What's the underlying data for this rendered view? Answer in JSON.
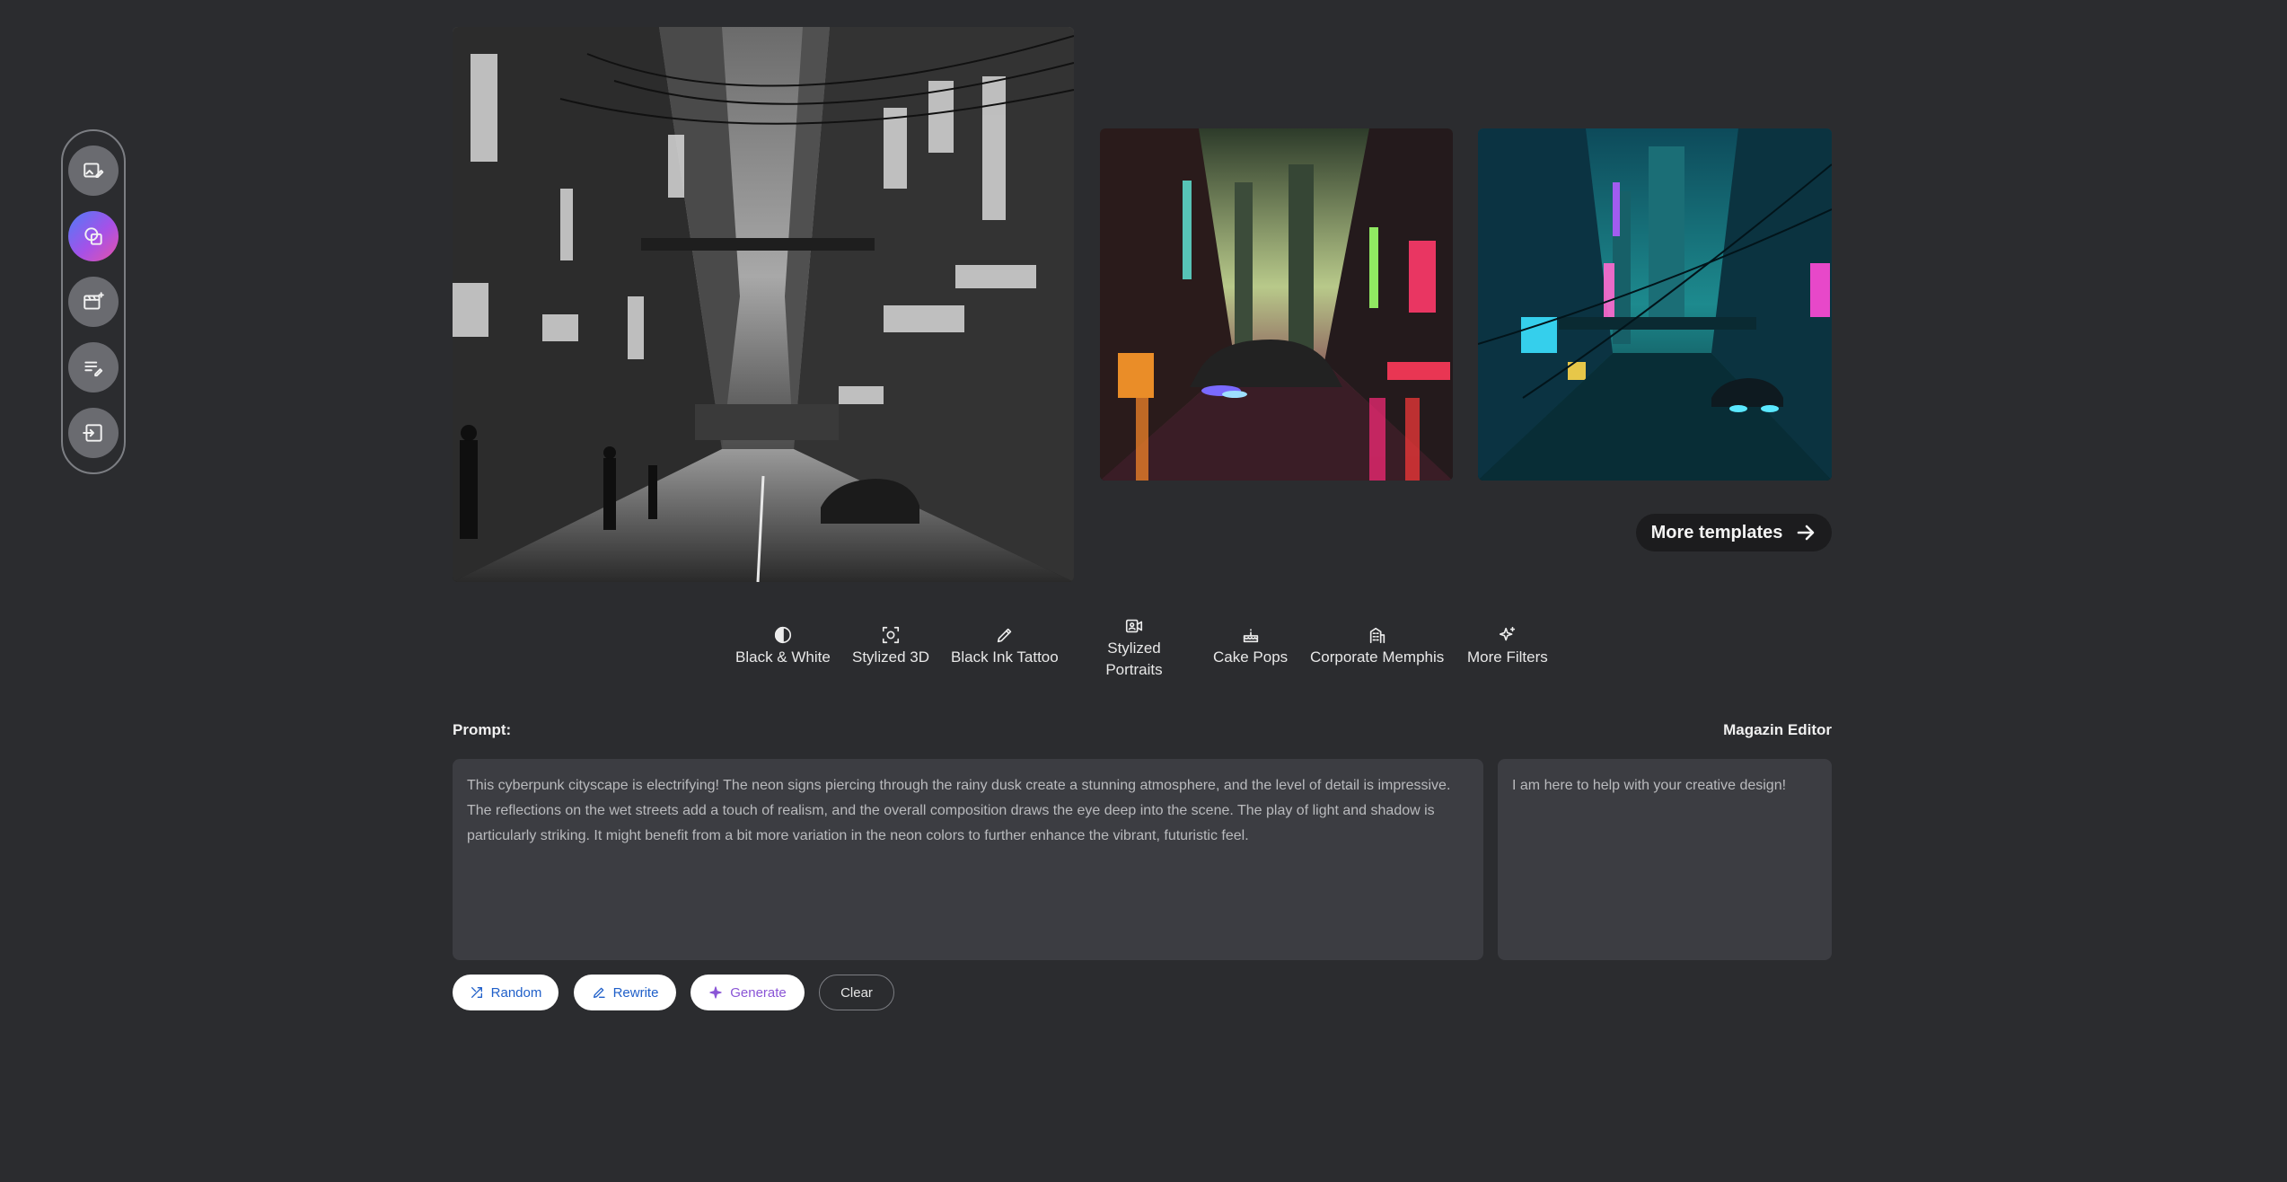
{
  "toolbar": {
    "items": [
      {
        "icon": "image-edit-icon"
      },
      {
        "icon": "shapes-icon",
        "active": true
      },
      {
        "icon": "image-sparkle-icon"
      },
      {
        "icon": "edit-list-icon"
      },
      {
        "icon": "sign-in-icon"
      }
    ]
  },
  "images": {
    "main": "black-and-white-cyberpunk-street",
    "template1": "neon-cyberpunk-street-flying-car",
    "template2": "teal-cyberpunk-city-flying-car"
  },
  "templates": {
    "more_label": "More templates",
    "icon": "arrow-right-icon"
  },
  "filters": [
    {
      "label": "Black & White",
      "icon": "contrast-icon"
    },
    {
      "label": "Stylized 3D",
      "icon": "3d-face-icon"
    },
    {
      "label": "Black Ink Tattoo",
      "icon": "pen-icon"
    },
    {
      "label": "Stylized Portraits",
      "icon": "portrait-video-icon"
    },
    {
      "label": "Cake Pops",
      "icon": "cake-icon"
    },
    {
      "label": "Corporate Memphis",
      "icon": "building-icon"
    },
    {
      "label": "More Filters",
      "icon": "sparkle-icon"
    }
  ],
  "prompt": {
    "label": "Prompt:",
    "text": "This cyberpunk cityscape is electrifying! The neon signs piercing through the rainy dusk create a stunning atmosphere, and the level of detail is impressive.  The reflections on the wet streets add a touch of realism, and the overall composition draws the eye deep into the scene. The play of light and shadow is particularly striking. It might benefit from a bit more variation in the neon colors to further enhance the vibrant, futuristic feel."
  },
  "editor": {
    "label": "Magazin Editor",
    "text": "I am here to help with your creative design!"
  },
  "actions": {
    "random": "Random",
    "rewrite": "Rewrite",
    "generate": "Generate",
    "clear": "Clear"
  }
}
